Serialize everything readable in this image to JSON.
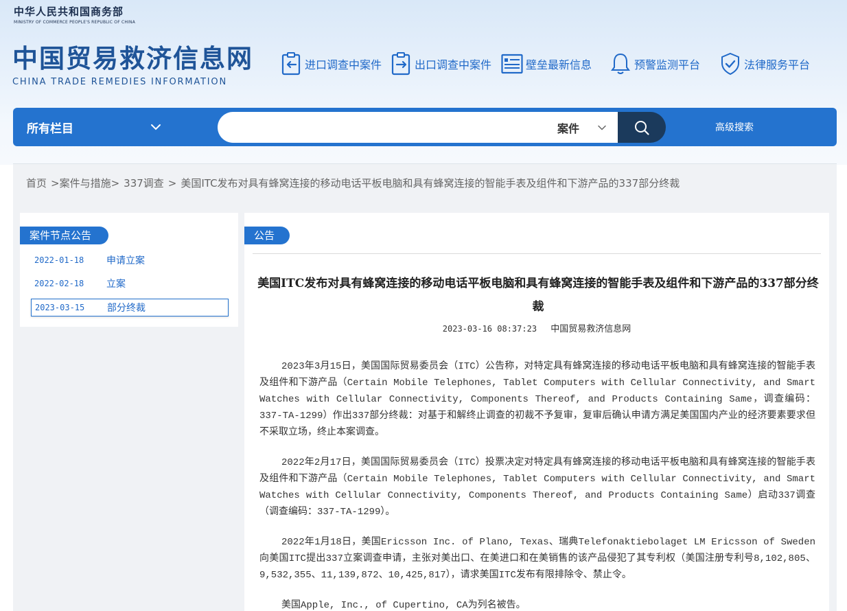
{
  "header": {
    "ministry_cn": "中华人民共和国商务部",
    "ministry_en": "MINISTRY OF COMMERCE PEOPLE'S REPUBLIC OF CHINA",
    "site_cn": "中国贸易救济信息网",
    "site_en": "CHINA TRADE REMEDIES INFORMATION",
    "nav": [
      {
        "label": "进口调查中案件",
        "icon": "import-clipboard-icon"
      },
      {
        "label": "出口调查中案件",
        "icon": "export-clipboard-icon"
      },
      {
        "label": "壁垒最新信息",
        "icon": "document-list-icon"
      },
      {
        "label": "预警监测平台",
        "icon": "bell-icon"
      },
      {
        "label": "法律服务平台",
        "icon": "shield-check-icon"
      }
    ]
  },
  "search": {
    "category": "所有栏目",
    "placeholder": "",
    "value": "",
    "type": "案件",
    "advanced": "高级搜索",
    "accent": "#2473cf",
    "button_color": "#1b3a5c"
  },
  "breadcrumb": {
    "items": [
      "首页",
      ">案件与措施>",
      "337调查",
      ">",
      "美国ITC发布对具有蜂窝连接的移动电话平板电脑和具有蜂窝连接的智能手表及组件和下游产品的337部分终裁"
    ]
  },
  "sidebar": {
    "title": "案件节点公告",
    "nodes": [
      {
        "date": "2022-01-18",
        "label": "申请立案"
      },
      {
        "date": "2022-02-18",
        "label": "立案"
      },
      {
        "date": "2023-03-15",
        "label": "部分终裁"
      }
    ]
  },
  "article": {
    "tag": "公告",
    "title": "美国ITC发布对具有蜂窝连接的移动电话平板电脑和具有蜂窝连接的智能手表及组件和下游产品的337部分终裁",
    "date": "2023-03-16 08:37:23",
    "source": "中国贸易救济信息网",
    "paragraphs": [
      "2023年3月15日，美国国际贸易委员会（ITC）公告称，对特定具有蜂窝连接的移动电话平板电脑和具有蜂窝连接的智能手表及组件和下游产品（Certain Mobile Telephones, Tablet Computers with Cellular Connectivity, and Smart Watches with Cellular Connectivity, Components Thereof, and Products Containing Same，调查编码：337-TA-1299）作出337部分终裁：对基于和解终止调查的初裁不予复审，复审后确认申请方满足美国国内产业的经济要素要求但不采取立场，终止本案调查。",
      "2022年2月17日，美国国际贸易委员会（ITC）投票决定对特定具有蜂窝连接的移动电话平板电脑和具有蜂窝连接的智能手表及组件和下游产品（Certain Mobile Telephones, Tablet Computers with Cellular Connectivity, and Smart Watches with Cellular Connectivity, Components Thereof, and Products Containing Same）启动337调查（调查编码：337-TA-1299）。",
      "2022年1月18日，美国Ericsson Inc. of Plano, Texas、瑞典Telefonaktiebolaget LM Ericsson of Sweden向美国ITC提出337立案调查申请，主张对美出口、在美进口和在美销售的该产品侵犯了其专利权（美国注册专利号8,102,805、9,532,355、11,139,872、10,425,817），请求美国ITC发布有限排除令、禁止令。",
      "美国Apple, Inc., of Cupertino, CA为列名被告。"
    ]
  }
}
